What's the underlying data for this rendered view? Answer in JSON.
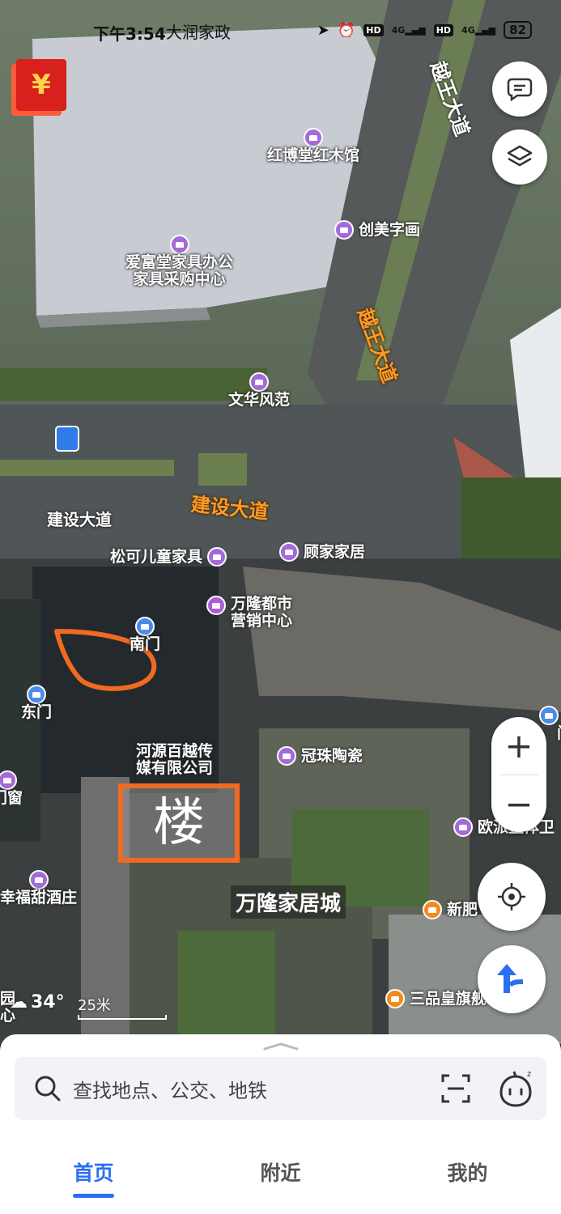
{
  "status_bar": {
    "time": "下午3:54",
    "top_label": "大润家政",
    "net1": "HD",
    "net2": "4G",
    "net3": "HD",
    "net4": "4G",
    "battery": "82"
  },
  "red_packet": {
    "symbol": "¥"
  },
  "map": {
    "roads": {
      "yuewang_top": "越王大道",
      "yuewang_mid": "越王大道",
      "jianshe_orange": "建设大道",
      "jianshe_white": "建设大道"
    },
    "pois": {
      "hongbotang": "红博堂红木馆",
      "chuangmei": "创美字画",
      "aifutang_1": "爱富堂家具办公",
      "aifutang_2": "家具采购中心",
      "wenhua": "文华风范",
      "songke": "松可儿童家具",
      "gujia": "顾家家居",
      "wanlong_1": "万隆都市",
      "wanlong_2": "营销中心",
      "nanmen": "南门",
      "dongmen": "东门",
      "dongmen_right": "门",
      "heyuan_1": "河源百越传",
      "heyuan_2": "媒有限公司",
      "guanzhu": "冠珠陶瓷",
      "menchuang": "门窗",
      "oupai": "欧派整体卫",
      "xingfutian": "幸福甜酒庄",
      "xinfei": "新肥",
      "sanpin": "三品皇旗舰",
      "yuan_1": "园",
      "yuan_2": "心"
    },
    "wanlong_home": "万隆家居城",
    "annotation_text": "楼",
    "weather_temp": "34°",
    "scale_text": "25米"
  },
  "controls": {
    "chat": "chat-bubble-icon",
    "layers": "layers-icon",
    "zoom_in": "+",
    "zoom_out": "−",
    "locate": "locate-icon",
    "navigate": "route-arrow-icon"
  },
  "search": {
    "placeholder": "查找地点、公交、地铁"
  },
  "tabs": [
    {
      "label": "首页",
      "active": true
    },
    {
      "label": "附近",
      "active": false
    },
    {
      "label": "我的",
      "active": false
    }
  ],
  "colors": {
    "accent": "#2b6ef0",
    "poi_purple": "#a46ad9",
    "road_label": "#ff9b26",
    "annotation": "#f06a22"
  }
}
